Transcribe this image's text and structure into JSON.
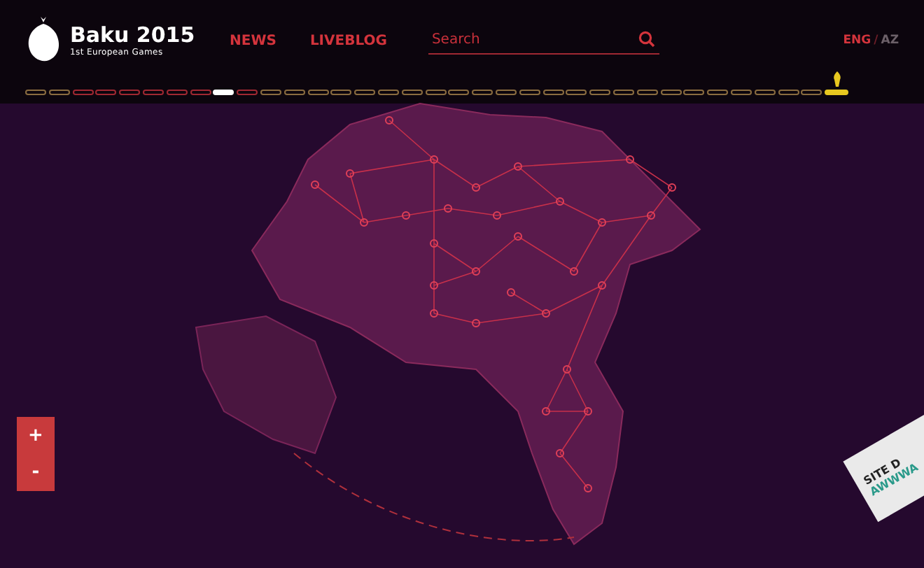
{
  "header": {
    "logo_title": "Baku 2015",
    "logo_subtitle": "1st European Games",
    "nav": [
      {
        "label": "NEWS"
      },
      {
        "label": "LIVEBLOG"
      }
    ],
    "search": {
      "placeholder": "Search"
    },
    "languages": [
      {
        "label": "ENG",
        "selected": true
      },
      {
        "label": "AZ",
        "selected": false
      }
    ],
    "separator": "/"
  },
  "timeline": [
    {
      "kind": "future"
    },
    {
      "kind": "future"
    },
    {
      "kind": "past"
    },
    {
      "kind": "past"
    },
    {
      "kind": "past"
    },
    {
      "kind": "past"
    },
    {
      "kind": "past"
    },
    {
      "kind": "past"
    },
    {
      "kind": "current"
    },
    {
      "kind": "past"
    },
    {
      "kind": "future"
    },
    {
      "kind": "future"
    },
    {
      "kind": "future"
    },
    {
      "kind": "future"
    },
    {
      "kind": "future"
    },
    {
      "kind": "future"
    },
    {
      "kind": "future"
    },
    {
      "kind": "future"
    },
    {
      "kind": "future"
    },
    {
      "kind": "future"
    },
    {
      "kind": "future"
    },
    {
      "kind": "future"
    },
    {
      "kind": "future"
    },
    {
      "kind": "future"
    },
    {
      "kind": "future"
    },
    {
      "kind": "future"
    },
    {
      "kind": "future"
    },
    {
      "kind": "future"
    },
    {
      "kind": "future"
    },
    {
      "kind": "future"
    },
    {
      "kind": "future"
    },
    {
      "kind": "future"
    },
    {
      "kind": "future"
    },
    {
      "kind": "future"
    },
    {
      "kind": "final"
    }
  ],
  "zoom": [
    {
      "label": "+"
    },
    {
      "label": "-"
    }
  ],
  "badge": {
    "line_1": "SITE D",
    "line_2": "AWWWA"
  }
}
